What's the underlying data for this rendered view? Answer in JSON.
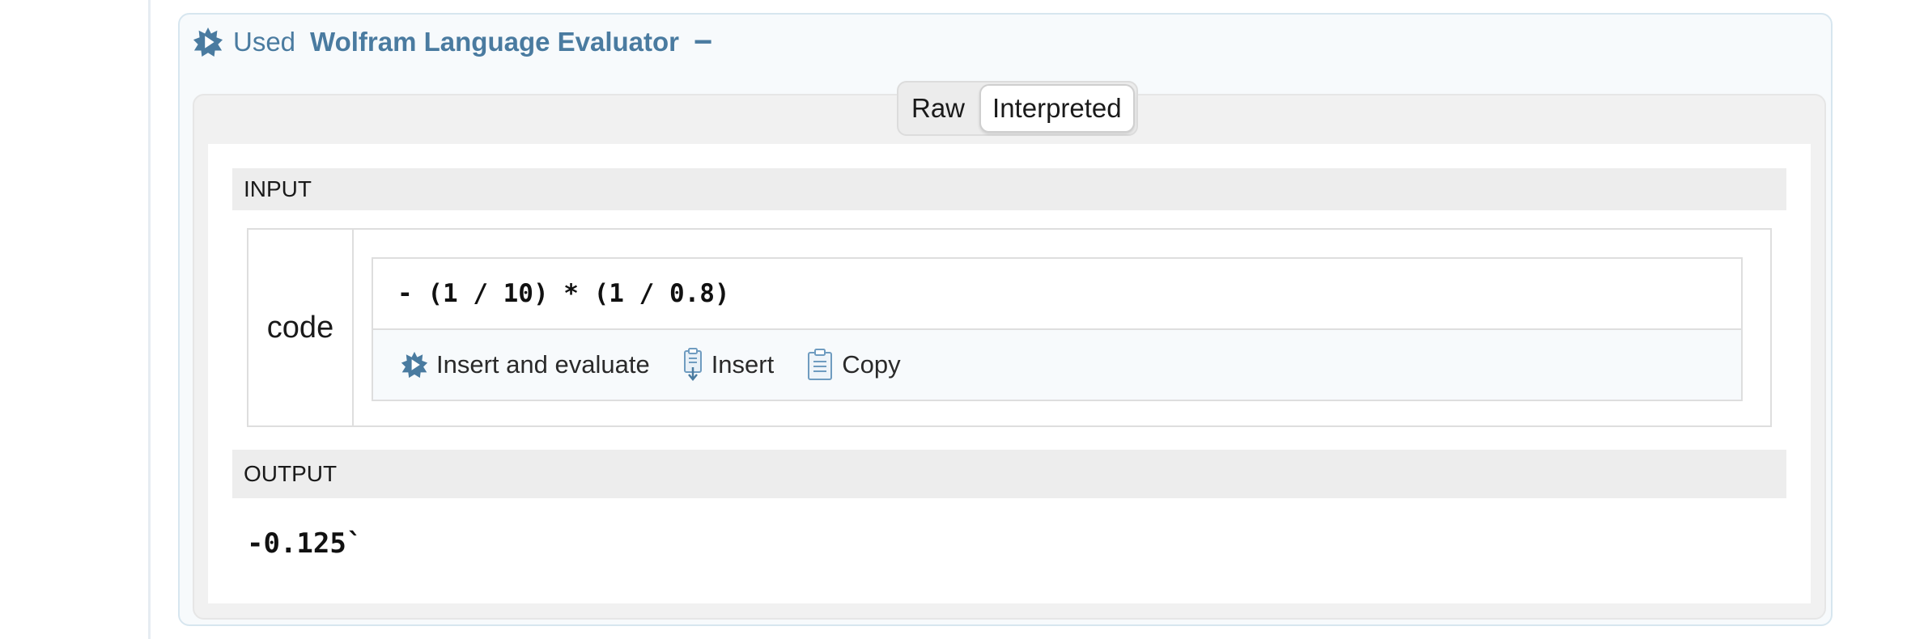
{
  "tool_call": {
    "used_label": "Used",
    "tool_name": "Wolfram Language Evaluator",
    "collapse_symbol": "−",
    "icon": "wolfram-spiky-icon"
  },
  "view_toggle": {
    "options": [
      "Raw",
      "Interpreted"
    ],
    "selected": "Interpreted"
  },
  "input": {
    "section_label": "INPUT",
    "param_name": "code",
    "code": "- (1 / 10) * (1 / 0.8)",
    "actions": [
      {
        "label": "Insert and evaluate",
        "icon": "wolfram-spiky-icon"
      },
      {
        "label": "Insert",
        "icon": "insert-clipboard-icon"
      },
      {
        "label": "Copy",
        "icon": "copy-clipboard-icon"
      }
    ]
  },
  "output": {
    "section_label": "OUTPUT",
    "value": "-0.125`"
  },
  "colors": {
    "accent": "#4a7ba0",
    "panel_border": "#d7e6ef",
    "section_bg": "#ededed"
  }
}
